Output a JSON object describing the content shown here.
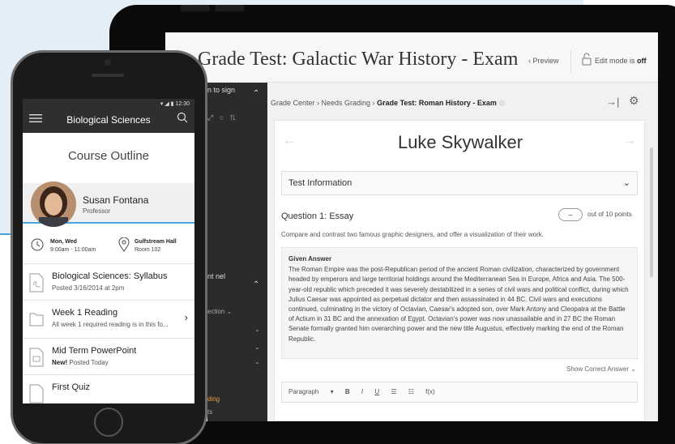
{
  "tablet": {
    "test_title": "Grade Test:  Galactic War History - Exam",
    "preview_label": "Preview",
    "edit_mode": "Edit mode is",
    "edit_mode_value": "off",
    "sidebar": {
      "section1": "n to sign",
      "section2": "nt nel",
      "row1": "ection",
      "accent": "ding",
      "row_last": "ts"
    },
    "breadcrumb": "Grade Center › Needs Grading › ",
    "breadcrumb_current": "Grade Test: Roman History - Exam",
    "student_name": "Luke Skywalker",
    "test_information": "Test Information",
    "question_title": "Question 1: Essay",
    "points_label": "out of 10 points",
    "prompt": "Compare and contrast two famous graphic designers, and offer a visualization of their work.",
    "answer_title": "Given Answer",
    "answer_text": "The Roman Empire was the post-Republican period of the ancient Roman civilization, characterized by government headed by emperors and large territorial holdings around the Mediterranean Sea in Europe, Africa and Asia. The 500-year-old republic which preceded it was severely destabilized in a series of civil wars and political conflict, during which Julius Caesar was appointed as perpetual dictator and then assassinated in 44 BC. Civil wars and executions continued, culminating in the victory of Octavian, Caesar's adopted son, over Mark Antony and Cleopatra at the Battle of Actium in 31 BC and the annexation of Egypt. Octavian's power was now unassailable and in 27 BC the Roman Senate formally granted him overarching power and the new title Augustus, effectively marking the end of the Roman Republic.",
    "show_correct": "Show Correct Answer",
    "editor": {
      "paragraph": "Paragraph",
      "bold": "B",
      "italic": "I",
      "underline": "U",
      "fx": "f(x)"
    }
  },
  "phone": {
    "status": "12:30",
    "title": "Biological Sciences",
    "course_outline": "Course Outline",
    "professor_name": "Susan Fontana",
    "professor_role": "Professor",
    "day": "Mon, Wed",
    "time": "9:00am - 11:00am",
    "location": "Gulfstream Hall",
    "room": "Room 102",
    "items": [
      {
        "title": "Biological Sciences: Syllabus",
        "sub": "Posted 3/16/2014 at 2pm",
        "badge": ""
      },
      {
        "title": "Week 1 Reading",
        "sub": "All week 1 required reading is in this fo...",
        "badge": ""
      },
      {
        "title": "Mid Term PowerPoint",
        "sub": "Posted Today",
        "badge": "New!"
      },
      {
        "title": "First Quiz",
        "sub": "",
        "badge": ""
      }
    ]
  },
  "colors": {
    "accent": "#4aa3dc",
    "phone_header": "#2f2f2f",
    "sidebar": "#2b2b2b"
  }
}
